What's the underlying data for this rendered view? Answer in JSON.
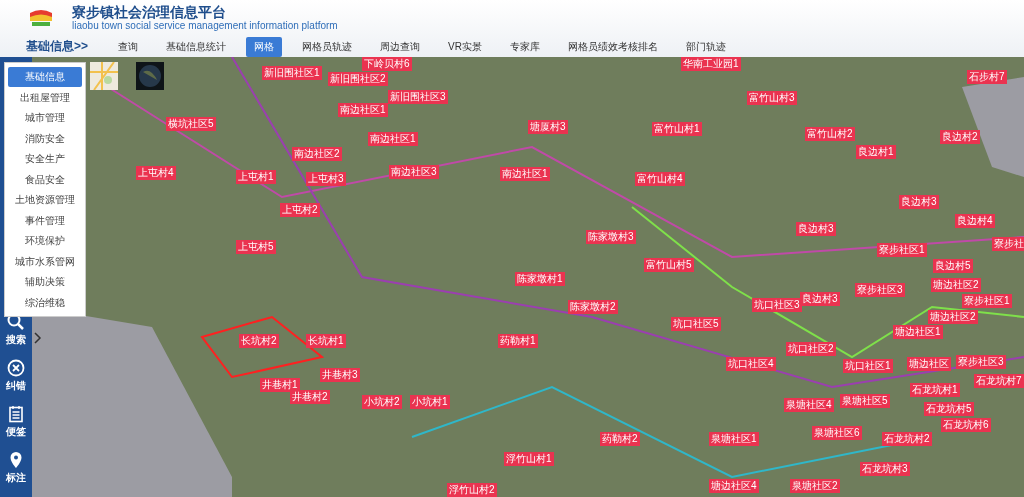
{
  "header": {
    "title": "寮步镇社会治理信息平台",
    "subtitle": "liaobu town social service management information platform"
  },
  "nav": {
    "section": "基础信息>>",
    "items": [
      {
        "label": "查询",
        "selected": false
      },
      {
        "label": "基础信息统计",
        "selected": false
      },
      {
        "label": "网格",
        "selected": true
      },
      {
        "label": "网格员轨迹",
        "selected": false
      },
      {
        "label": "周边查询",
        "selected": false
      },
      {
        "label": "VR实景",
        "selected": false
      },
      {
        "label": "专家库",
        "selected": false
      },
      {
        "label": "网格员绩效考核排名",
        "selected": false
      },
      {
        "label": "部门轨迹",
        "selected": false
      }
    ]
  },
  "category_menu": {
    "items": [
      {
        "label": "基础信息",
        "selected": true
      },
      {
        "label": "出租屋管理",
        "selected": false
      },
      {
        "label": "城市管理",
        "selected": false
      },
      {
        "label": "消防安全",
        "selected": false
      },
      {
        "label": "安全生产",
        "selected": false
      },
      {
        "label": "食品安全",
        "selected": false
      },
      {
        "label": "土地资源管理",
        "selected": false
      },
      {
        "label": "事件管理",
        "selected": false
      },
      {
        "label": "环境保护",
        "selected": false
      },
      {
        "label": "城市水系管网",
        "selected": false
      },
      {
        "label": "辅助决策",
        "selected": false
      },
      {
        "label": "综治维稳",
        "selected": false
      }
    ]
  },
  "tools": [
    {
      "label": "搜索",
      "kind": "search"
    },
    {
      "label": "纠错",
      "kind": "correct"
    },
    {
      "label": "便签",
      "kind": "note"
    },
    {
      "label": "标注",
      "kind": "pin"
    }
  ],
  "map": {
    "labels": [
      "新旧围社区1",
      "新旧围社区2",
      "下岭贝村6",
      "新旧围社区3",
      "南边社区1",
      "南边社区1",
      "横坑社区5",
      "南边社区2",
      "上屯村4",
      "上屯村1",
      "上屯村3",
      "南边社区3",
      "南边社区1",
      "塘厦村3",
      "上屯村2",
      "上屯村5",
      "华南工业园1",
      "石步村7",
      "富竹山村3",
      "富竹山村1",
      "富竹山村2",
      "良边村1",
      "良边村2",
      "富竹山村4",
      "良边村3",
      "良边村4",
      "陈家墩村3",
      "良边村3",
      "富竹山村5",
      "寮步社区1",
      "良边村5",
      "寮步社",
      "陈家墩村1",
      "长坑村2",
      "长坑村1",
      "药勒村1",
      "井巷村3",
      "井巷村1",
      "井巷村2",
      "小坑村2",
      "小坑村1",
      "浮竹山村1",
      "浮竹山村2",
      "陈家墩村2",
      "坑口社区3",
      "良边村3",
      "寮步社区3",
      "塘边社区2",
      "寮步社区1",
      "塘边社区2",
      "坑口社区5",
      "塘边社区1",
      "坑口社区2",
      "坑口社区4",
      "坑口社区1",
      "塘边社区",
      "寮步社区3",
      "石龙坑村1",
      "石龙坑村7",
      "泉塘社区4",
      "泉塘社区5",
      "石龙坑村5",
      "石龙坑村6",
      "泉塘社区6",
      "药勒村2",
      "泉塘社区1",
      "石龙坑村2",
      "石龙坑村3",
      "塘边社区4",
      "泉塘社区2"
    ]
  }
}
